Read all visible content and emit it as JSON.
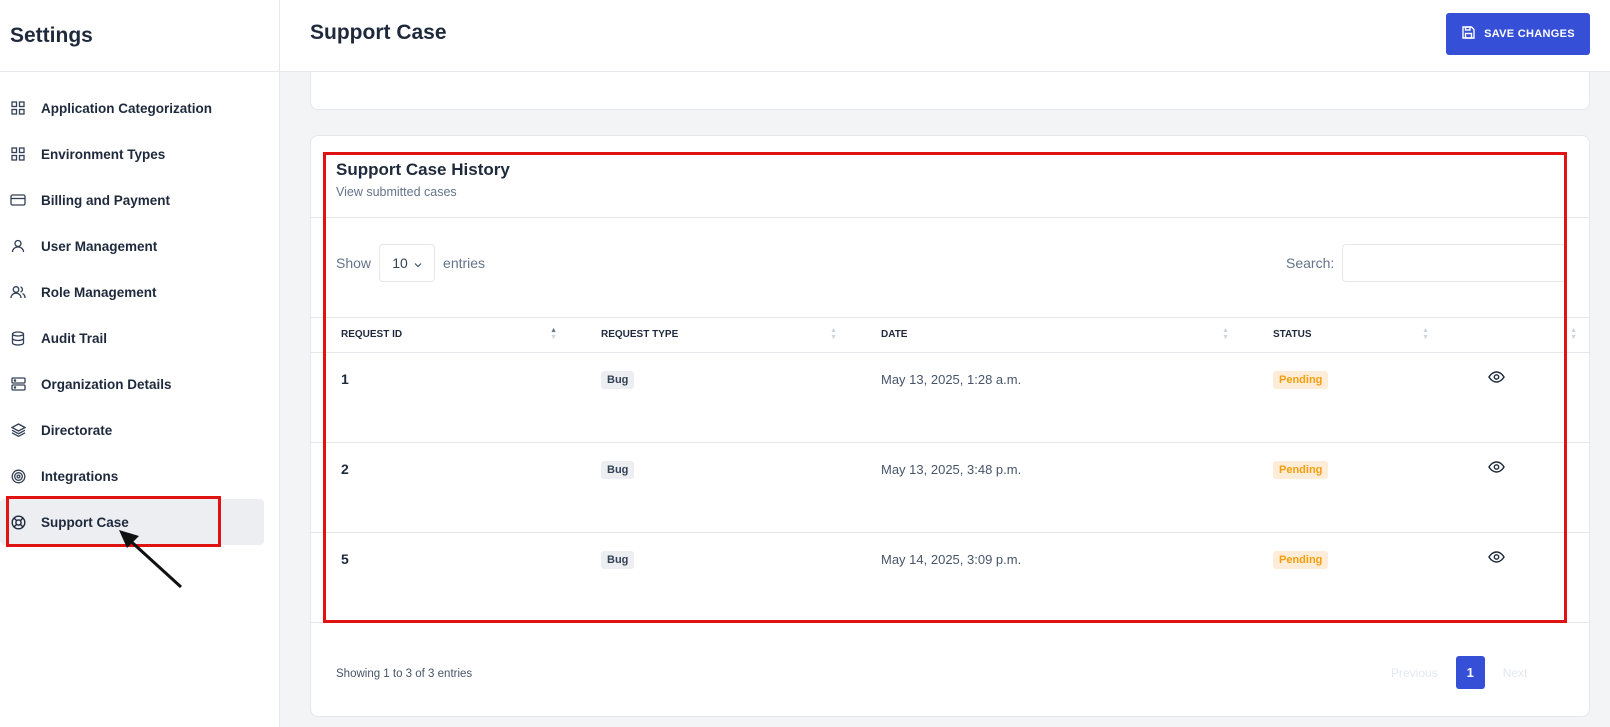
{
  "sidebar": {
    "title": "Settings",
    "items": [
      {
        "label": "Application Categorization",
        "icon": "grid-icon"
      },
      {
        "label": "Environment Types",
        "icon": "grid-icon"
      },
      {
        "label": "Billing and Payment",
        "icon": "credit-card-icon"
      },
      {
        "label": "User Management",
        "icon": "user-icon"
      },
      {
        "label": "Role Management",
        "icon": "users-icon"
      },
      {
        "label": "Audit Trail",
        "icon": "database-icon"
      },
      {
        "label": "Organization Details",
        "icon": "server-icon"
      },
      {
        "label": "Directorate",
        "icon": "layers-icon"
      },
      {
        "label": "Integrations",
        "icon": "target-icon"
      },
      {
        "label": "Support Case",
        "icon": "lifebuoy-icon"
      }
    ],
    "active": "Support Case"
  },
  "header": {
    "title": "Support Case",
    "save_label": "SAVE CHANGES"
  },
  "history": {
    "title": "Support Case History",
    "subtitle": "View submitted cases",
    "show_label": "Show",
    "entries_value": "10",
    "entries_label": "entries",
    "search_label": "Search:",
    "columns": [
      "REQUEST ID",
      "REQUEST TYPE",
      "DATE",
      "STATUS"
    ],
    "rows": [
      {
        "id": "1",
        "type": "Bug",
        "date": "May 13, 2025, 1:28 a.m.",
        "status": "Pending"
      },
      {
        "id": "2",
        "type": "Bug",
        "date": "May 13, 2025, 3:48 p.m.",
        "status": "Pending"
      },
      {
        "id": "5",
        "type": "Bug",
        "date": "May 14, 2025, 3:09 p.m.",
        "status": "Pending"
      }
    ],
    "info": "Showing 1 to 3 of 3 entries",
    "pager": {
      "previous": "Previous",
      "current": "1",
      "next": "Next"
    }
  },
  "colors": {
    "accent": "#3550d6",
    "highlight": "#e01212",
    "pending": "#f59e0b"
  }
}
